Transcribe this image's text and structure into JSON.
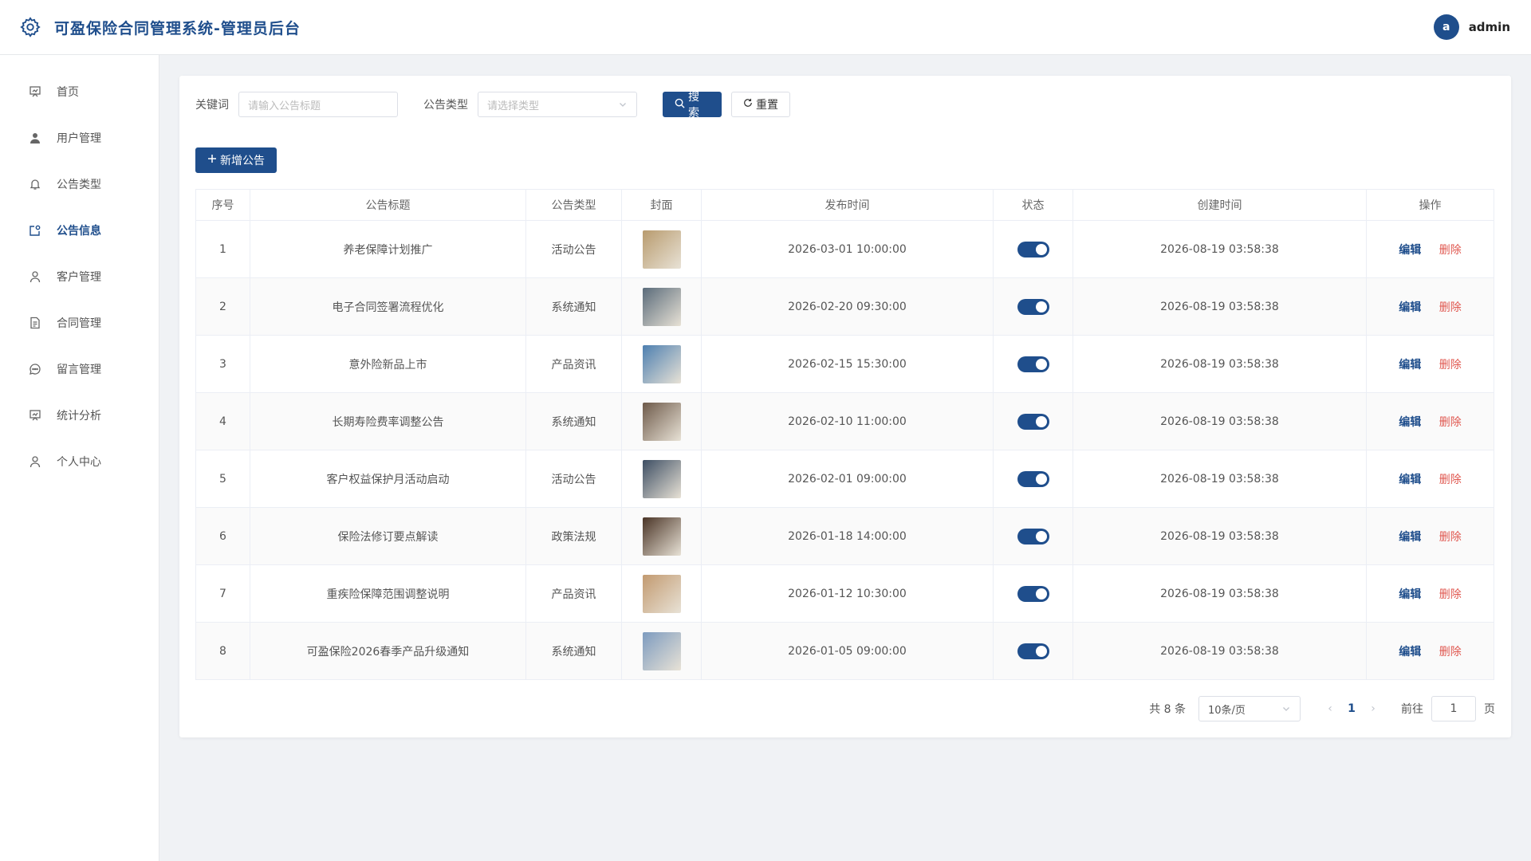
{
  "app": {
    "title": "可盈保险合同管理系统-管理员后台",
    "user": {
      "avatar_letter": "a",
      "name": "admin"
    }
  },
  "sidebar": {
    "items": [
      {
        "label": "首页",
        "icon": "home-board-icon",
        "active": false
      },
      {
        "label": "用户管理",
        "icon": "user-filled-icon",
        "active": false
      },
      {
        "label": "公告类型",
        "icon": "bell-icon",
        "active": false
      },
      {
        "label": "公告信息",
        "icon": "notice-edit-icon",
        "active": true
      },
      {
        "label": "客户管理",
        "icon": "user-outline-icon",
        "active": false
      },
      {
        "label": "合同管理",
        "icon": "document-icon",
        "active": false
      },
      {
        "label": "留言管理",
        "icon": "chat-icon",
        "active": false
      },
      {
        "label": "统计分析",
        "icon": "chart-board-icon",
        "active": false
      },
      {
        "label": "个人中心",
        "icon": "profile-icon",
        "active": false
      }
    ]
  },
  "search": {
    "keyword_label": "关键词",
    "keyword_placeholder": "请输入公告标题",
    "type_label": "公告类型",
    "type_placeholder": "请选择类型",
    "search_label": "搜索",
    "reset_label": "重置"
  },
  "toolbar": {
    "add_label": "新增公告"
  },
  "table": {
    "columns": [
      "序号",
      "公告标题",
      "公告类型",
      "封面",
      "发布时间",
      "状态",
      "创建时间",
      "操作"
    ],
    "rows": [
      {
        "no": "1",
        "title": "养老保障计划推广",
        "type": "活动公告",
        "publish": "2026-03-01 10:00:00",
        "created": "2026-08-19 03:58:38",
        "enabled": true,
        "cover_color": "#b89b6e"
      },
      {
        "no": "2",
        "title": "电子合同签署流程优化",
        "type": "系统通知",
        "publish": "2026-02-20 09:30:00",
        "created": "2026-08-19 03:58:38",
        "enabled": true,
        "cover_color": "#5a6b7a"
      },
      {
        "no": "3",
        "title": "意外险新品上市",
        "type": "产品资讯",
        "publish": "2026-02-15 15:30:00",
        "created": "2026-08-19 03:58:38",
        "enabled": true,
        "cover_color": "#4d7fb0"
      },
      {
        "no": "4",
        "title": "长期寿险费率调整公告",
        "type": "系统通知",
        "publish": "2026-02-10 11:00:00",
        "created": "2026-08-19 03:58:38",
        "enabled": true,
        "cover_color": "#6e5a4a"
      },
      {
        "no": "5",
        "title": "客户权益保护月活动启动",
        "type": "活动公告",
        "publish": "2026-02-01 09:00:00",
        "created": "2026-08-19 03:58:38",
        "enabled": true,
        "cover_color": "#3d4e63"
      },
      {
        "no": "6",
        "title": "保险法修订要点解读",
        "type": "政策法规",
        "publish": "2026-01-18 14:00:00",
        "created": "2026-08-19 03:58:38",
        "enabled": true,
        "cover_color": "#4a3426"
      },
      {
        "no": "7",
        "title": "重疾险保障范围调整说明",
        "type": "产品资讯",
        "publish": "2026-01-12 10:30:00",
        "created": "2026-08-19 03:58:38",
        "enabled": true,
        "cover_color": "#c29a70"
      },
      {
        "no": "8",
        "title": "可盈保险2026春季产品升级通知",
        "type": "系统通知",
        "publish": "2026-01-05 09:00:00",
        "created": "2026-08-19 03:58:38",
        "enabled": true,
        "cover_color": "#7d9bbf"
      }
    ],
    "actions": {
      "edit": "编辑",
      "delete": "删除"
    }
  },
  "pagination": {
    "total": "共 8 条",
    "page_size": "10条/页",
    "current_page": "1",
    "goto_prefix": "前往",
    "goto_value": "1",
    "goto_suffix": "页"
  },
  "colors": {
    "primary": "#1f4e8c",
    "danger": "#e0574f"
  }
}
